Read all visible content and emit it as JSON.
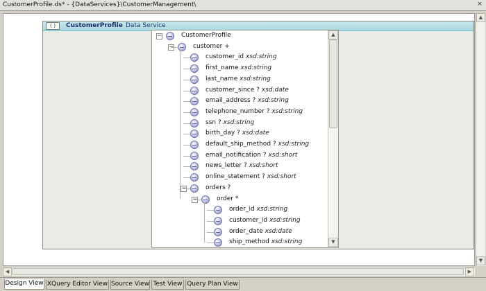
{
  "window": {
    "title": "CustomerProfile.ds* - {DataServices}\\CustomerManagement\\",
    "close_label": "×"
  },
  "panel": {
    "icon_text": "{ }",
    "title": "CustomerProfile",
    "type_label": "Data Service"
  },
  "tree": {
    "rows": [
      {
        "name": "CustomerProfile",
        "type": "",
        "toggle": "−",
        "level": 0
      },
      {
        "name": "customer +",
        "type": "",
        "toggle": "−",
        "level": 1
      },
      {
        "name": "customer_id",
        "type": "xsd:string",
        "toggle": "",
        "level": 2
      },
      {
        "name": "first_name",
        "type": "xsd:string",
        "toggle": "",
        "level": 2
      },
      {
        "name": "last_name",
        "type": "xsd:string",
        "toggle": "",
        "level": 2
      },
      {
        "name": "customer_since ?",
        "type": "xsd:date",
        "toggle": "",
        "level": 2
      },
      {
        "name": "email_address ?",
        "type": "xsd:string",
        "toggle": "",
        "level": 2
      },
      {
        "name": "telephone_number ?",
        "type": "xsd:string",
        "toggle": "",
        "level": 2
      },
      {
        "name": "ssn ?",
        "type": "xsd:string",
        "toggle": "",
        "level": 2
      },
      {
        "name": "birth_day ?",
        "type": "xsd:date",
        "toggle": "",
        "level": 2
      },
      {
        "name": "default_ship_method ?",
        "type": "xsd:string",
        "toggle": "",
        "level": 2
      },
      {
        "name": "email_notification ?",
        "type": "xsd:short",
        "toggle": "",
        "level": 2
      },
      {
        "name": "news_letter ?",
        "type": "xsd:short",
        "toggle": "",
        "level": 2
      },
      {
        "name": "online_statement ?",
        "type": "xsd:short",
        "toggle": "",
        "level": 2
      },
      {
        "name": "orders ?",
        "type": "",
        "toggle": "−",
        "level": 2
      },
      {
        "name": "order *",
        "type": "",
        "toggle": "−",
        "level": 3
      },
      {
        "name": "order_id",
        "type": "xsd:string",
        "toggle": "",
        "level": 4
      },
      {
        "name": "customer_id",
        "type": "xsd:string",
        "toggle": "",
        "level": 4
      },
      {
        "name": "order_date",
        "type": "xsd:date",
        "toggle": "",
        "level": 4
      },
      {
        "name": "ship_method",
        "type": "xsd:string",
        "toggle": "",
        "level": 4
      }
    ]
  },
  "scroll": {
    "up_arrow": "▲",
    "down_arrow": "▼",
    "left_arrow": "◀",
    "right_arrow": "▶"
  },
  "tabs": [
    {
      "label": "Design View",
      "active": true
    },
    {
      "label": "XQuery Editor View",
      "active": false
    },
    {
      "label": "Source View",
      "active": false
    },
    {
      "label": "Test View",
      "active": false
    },
    {
      "label": "Query Plan View",
      "active": false
    }
  ]
}
